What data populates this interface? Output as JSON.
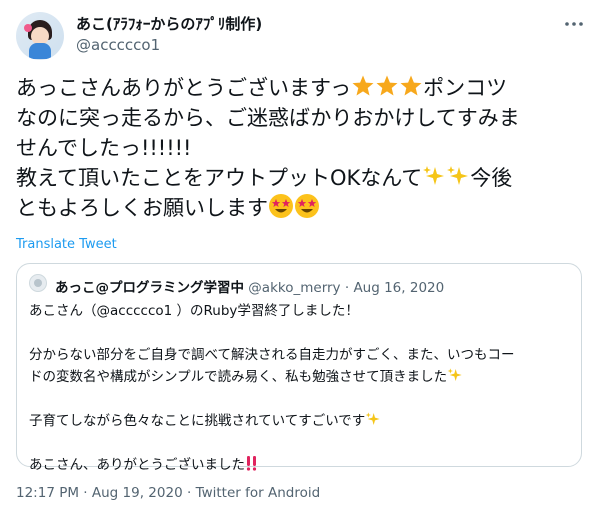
{
  "author": {
    "name": "あこ(ｱﾗﾌｫｰからのｱﾌﾟﾘ制作)",
    "handle": "@accccco1"
  },
  "tweet": {
    "line1_a": "あっこさんありがとうございますっ",
    "line1_b": "ポンコツ",
    "line2": "なのに突っ走るから、ご迷惑ばかりおかけしてすみま",
    "line3": "せんでしたっ!!!!!!",
    "line4_a": "教えて頂いたことをアウトプットOKなんて",
    "line4_b": "今後",
    "line5": "ともよろしくお願いします",
    "translate_label": "Translate Tweet"
  },
  "quoted": {
    "name": "あっこ@プログラミング学習中",
    "handle": "@akko_merry",
    "separator": "·",
    "date": "Aug 16, 2020",
    "lines": [
      "あこさん（@accccco1 ）のRuby学習終了しました！",
      "",
      "分からない部分をご自身で調べて解決される自走力がすごく、また、いつもコー",
      "ドの変数名や構成がシンプルで読み易く、私も勉強させて頂きました",
      "",
      "子育てしながら色々なことに挑戦されていてすごいです",
      "",
      "あこさん、ありがとうございました"
    ]
  },
  "footer": {
    "time": "12:17 PM",
    "separator": "·",
    "date": "Aug 19, 2020",
    "source": "Twitter for Android"
  },
  "colors": {
    "link": "#1d9bf0",
    "secondary": "#536471",
    "border": "#cfd9de",
    "star": "#f7a81c",
    "sparkle": "#f5c518",
    "exclaim": "#e0245e"
  }
}
